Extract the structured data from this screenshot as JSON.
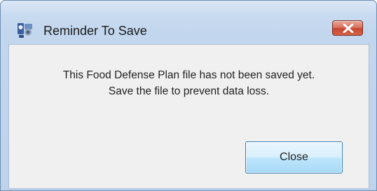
{
  "window": {
    "title": "Reminder To Save",
    "app_icon": "food-defense-app-icon",
    "close_icon": "close-x-icon"
  },
  "message": {
    "line1": "This Food Defense Plan file has not been saved yet.",
    "line2": "Save the file to prevent data loss."
  },
  "buttons": {
    "close_label": "Close"
  },
  "colors": {
    "frame": "#c2d6ee",
    "client": "#f0f0f0",
    "close_button_red": "#c7452e",
    "button_border": "#3c7fb1"
  }
}
